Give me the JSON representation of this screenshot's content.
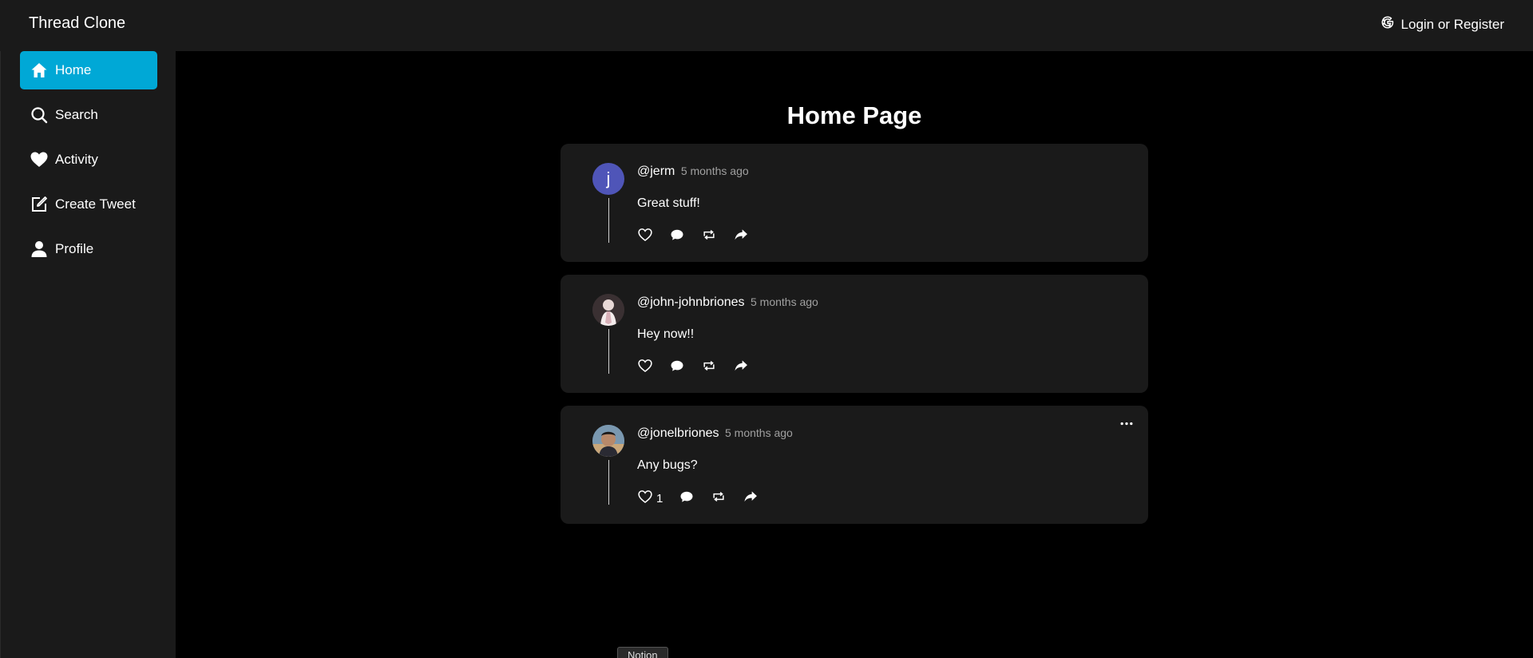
{
  "app": {
    "title": "Thread Clone",
    "login_label": "Login or Register"
  },
  "nav": [
    {
      "label": "Home",
      "icon": "home-icon",
      "active": true
    },
    {
      "label": "Search",
      "icon": "search-icon"
    },
    {
      "label": "Activity",
      "icon": "heart-icon"
    },
    {
      "label": "Create Tweet",
      "icon": "edit-icon"
    },
    {
      "label": "Profile",
      "icon": "user-icon"
    }
  ],
  "page": {
    "title": "Home Page"
  },
  "posts": [
    {
      "handle": "@jerm",
      "time": "5 months ago",
      "text": "Great stuff!",
      "avatar_letter": "j",
      "likes": ""
    },
    {
      "handle": "@john-johnbriones",
      "time": "5 months ago",
      "text": "Hey now!!",
      "avatar_letter": "",
      "likes": ""
    },
    {
      "handle": "@jonelbriones",
      "time": "5 months ago",
      "text": "Any bugs?",
      "avatar_letter": "",
      "likes": "1"
    }
  ],
  "tooltip": {
    "label": "Notion"
  },
  "colors": {
    "accent": "#00a8d6",
    "card": "#1a1a1a",
    "background": "#000000",
    "avatar_letter_bg": "#4f55b8"
  }
}
